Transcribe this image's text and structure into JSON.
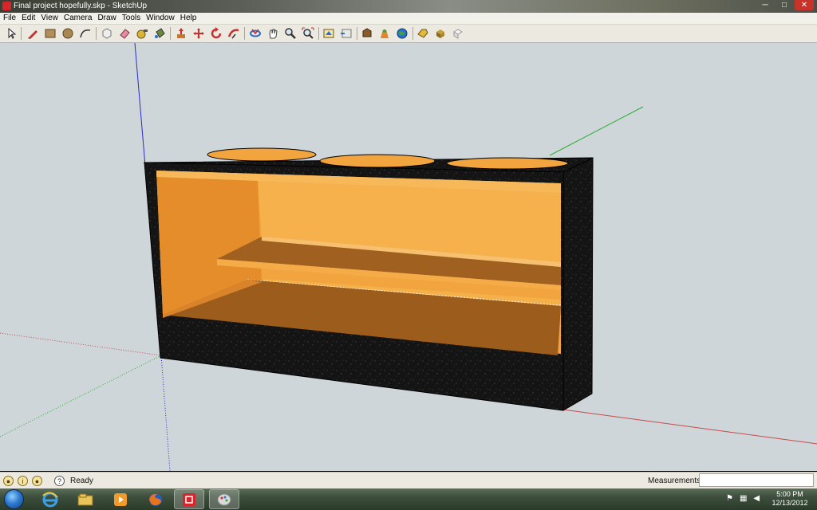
{
  "window": {
    "title": "Final project hopefully.skp - SketchUp",
    "controls": {
      "minimize": "─",
      "maximize": "□",
      "close": "✕"
    }
  },
  "menu": [
    "File",
    "Edit",
    "View",
    "Camera",
    "Draw",
    "Tools",
    "Window",
    "Help"
  ],
  "toolbar": {
    "tools": [
      "select-icon",
      "pencil-icon",
      "rectangle-icon",
      "circle-icon",
      "arc-icon",
      "make-component-icon",
      "eraser-icon",
      "tape-measure-icon",
      "paint-bucket-icon",
      "push-pull-icon",
      "move-icon",
      "rotate-icon",
      "follow-me-icon",
      "orbit-icon",
      "pan-icon",
      "zoom-icon",
      "zoom-extents-icon",
      "get-models-icon",
      "share-model-icon",
      "share-component-icon",
      "google-earth-icon",
      "toggle-terrain-icon",
      "add-location-icon",
      "get-photo-texture-icon",
      "photo-textures-icon",
      "preview-icon"
    ]
  },
  "status": {
    "text": "Ready",
    "help_icon": "?",
    "measurements_label": "Measurements",
    "measurements_value": ""
  },
  "taskbar": {
    "time": "5:00 PM",
    "date": "12/13/2012"
  },
  "colors": {
    "viewport_bg": "#ced6d9",
    "box_black": "#141414",
    "interior_orange": "#f2a43f",
    "floor_brown": "#9b5c1c",
    "axis_red": "#c84a4a",
    "axis_green": "#2fae33",
    "axis_blue": "#2a2ad0"
  }
}
